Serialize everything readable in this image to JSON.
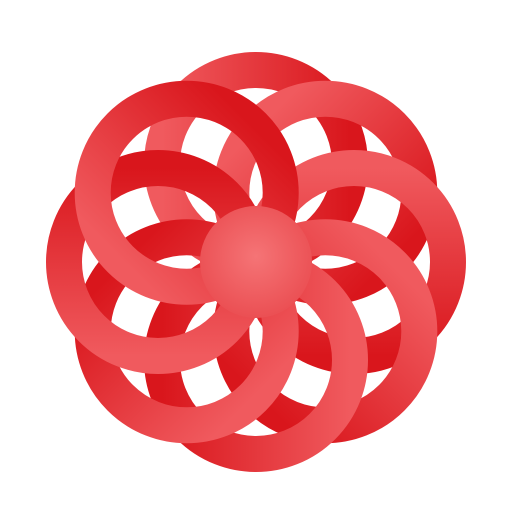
{
  "icon": {
    "name": "rosette-loops-logo",
    "ring_count": 8,
    "colors": {
      "background": "#ffffff",
      "ring_dark": "#d9161c",
      "ring_mid": "#e23a40",
      "ring_light": "#f05a5e",
      "center": "#f36a6c"
    }
  }
}
